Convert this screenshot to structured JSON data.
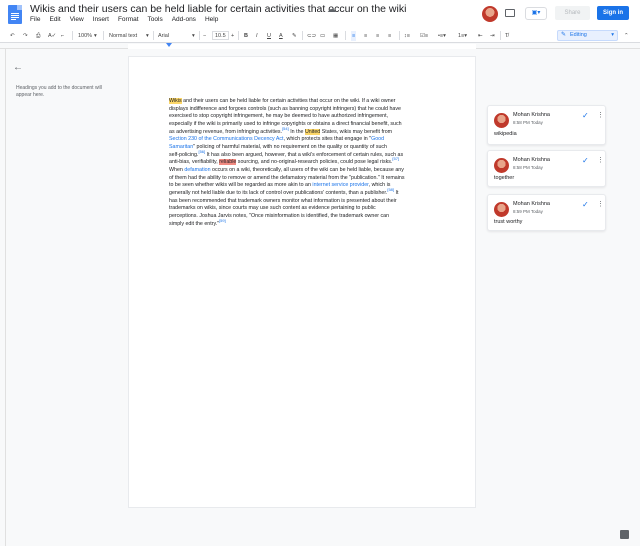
{
  "app": {
    "title": "Wikis and their users can be held liable for certain activities that occur on the wiki",
    "menu": [
      "File",
      "Edit",
      "View",
      "Insert",
      "Format",
      "Tools",
      "Add-ons",
      "Help"
    ],
    "share_label": "Share",
    "signin_label": "Sign in",
    "accent_color": "#1a73e8"
  },
  "toolbar": {
    "zoom": "100%",
    "style": "Normal text",
    "font": "Arial",
    "font_size": "10.5",
    "mode": "Editing",
    "icons": [
      "undo-icon",
      "redo-icon",
      "print-icon",
      "spellcheck-icon",
      "paint-format-icon",
      "bold-icon",
      "italic-icon",
      "underline-icon",
      "text-color-icon",
      "highlight-icon",
      "link-icon",
      "comment-icon",
      "image-icon",
      "align-left-icon",
      "align-center-icon",
      "align-right-icon",
      "justify-icon",
      "line-spacing-icon",
      "checklist-icon",
      "bulleted-list-icon",
      "numbered-list-icon",
      "decrease-indent-icon",
      "increase-indent-icon",
      "clear-format-icon"
    ]
  },
  "outline": {
    "hint": "Headings you add to the document will appear here."
  },
  "document": {
    "lines": [
      [
        {
          "t": "Wikis",
          "h": "y"
        },
        {
          "t": " and their users can be held liable for certain activities that occur on the wiki. If a wiki owner"
        }
      ],
      [
        {
          "t": "displays indifference and forgoes controls (such as banning copyright infringers) that he could have"
        }
      ],
      [
        {
          "t": "exercised to stop copyright infringement, he may be deemed to have authorized infringement,"
        }
      ],
      [
        {
          "t": "especially if the wiki is primarily used to infringe copyrights or obtains a direct financial benefit, such"
        }
      ],
      [
        {
          "t": "as advertising revenue, from infringing activities."
        },
        {
          "t": "[54]",
          "s": 1
        },
        {
          "t": " In the "
        },
        {
          "t": "United",
          "h": "y"
        },
        {
          "t": " States, wikis may benefit from"
        }
      ],
      [
        {
          "t": "Section 230 of the Communications Decency Act",
          "l": 1
        },
        {
          "t": ", which protects sites that engage in \""
        },
        {
          "t": "Good",
          "l": 1
        }
      ],
      [
        {
          "t": "Samaritan",
          "l": 1
        },
        {
          "t": "\" policing of harmful material, with no requirement on the quality or quantity of such"
        }
      ],
      [
        {
          "t": "self-policing."
        },
        {
          "t": "[56]",
          "s": 1
        },
        {
          "t": " It has also been argued, however, that a wiki's enforcement of certain rules, such as"
        }
      ],
      [
        {
          "t": "anti-bias, verifiability, "
        },
        {
          "t": "reliable",
          "h": "r"
        },
        {
          "t": " sourcing, and no-original-research policies, could pose legal risks."
        },
        {
          "t": "[57]",
          "s": 1
        }
      ],
      [
        {
          "t": "When "
        },
        {
          "t": "defamation",
          "l": 1
        },
        {
          "t": " occurs on a wiki, theoretically, all users of the wiki can be held liable, because any"
        }
      ],
      [
        {
          "t": "of them had the ability to remove or amend the defamatory material from the \"publication.\" It remains"
        }
      ],
      [
        {
          "t": "to be seen whether wikis will be regarded as more akin to an "
        },
        {
          "t": "internet service provider",
          "l": 1
        },
        {
          "t": ", which is"
        }
      ],
      [
        {
          "t": "generally not held liable due to its lack of control over publications' contents, than a publisher."
        },
        {
          "t": "[58]",
          "s": 1
        },
        {
          "t": " It"
        }
      ],
      [
        {
          "t": "has been recommended that trademark owners monitor what information is presented about their"
        }
      ],
      [
        {
          "t": "trademarks on wikis, since courts may use such content as evidence pertaining to public"
        }
      ],
      [
        {
          "t": "perceptions. Joshua Jarvis notes, \"Once misinformation is identified, the trademark owner can"
        }
      ],
      [
        {
          "t": "simply edit the entry.\""
        },
        {
          "t": "[59]",
          "s": 1
        }
      ]
    ]
  },
  "comments": [
    {
      "author": "Mohan Krishna",
      "time": "8:58 PM Today",
      "text": "wikipedia"
    },
    {
      "author": "Mohan Krishna",
      "time": "8:58 PM Today",
      "text": "together"
    },
    {
      "author": "Mohan Krishna",
      "time": "8:59 PM Today",
      "text": "trust worthy"
    }
  ]
}
